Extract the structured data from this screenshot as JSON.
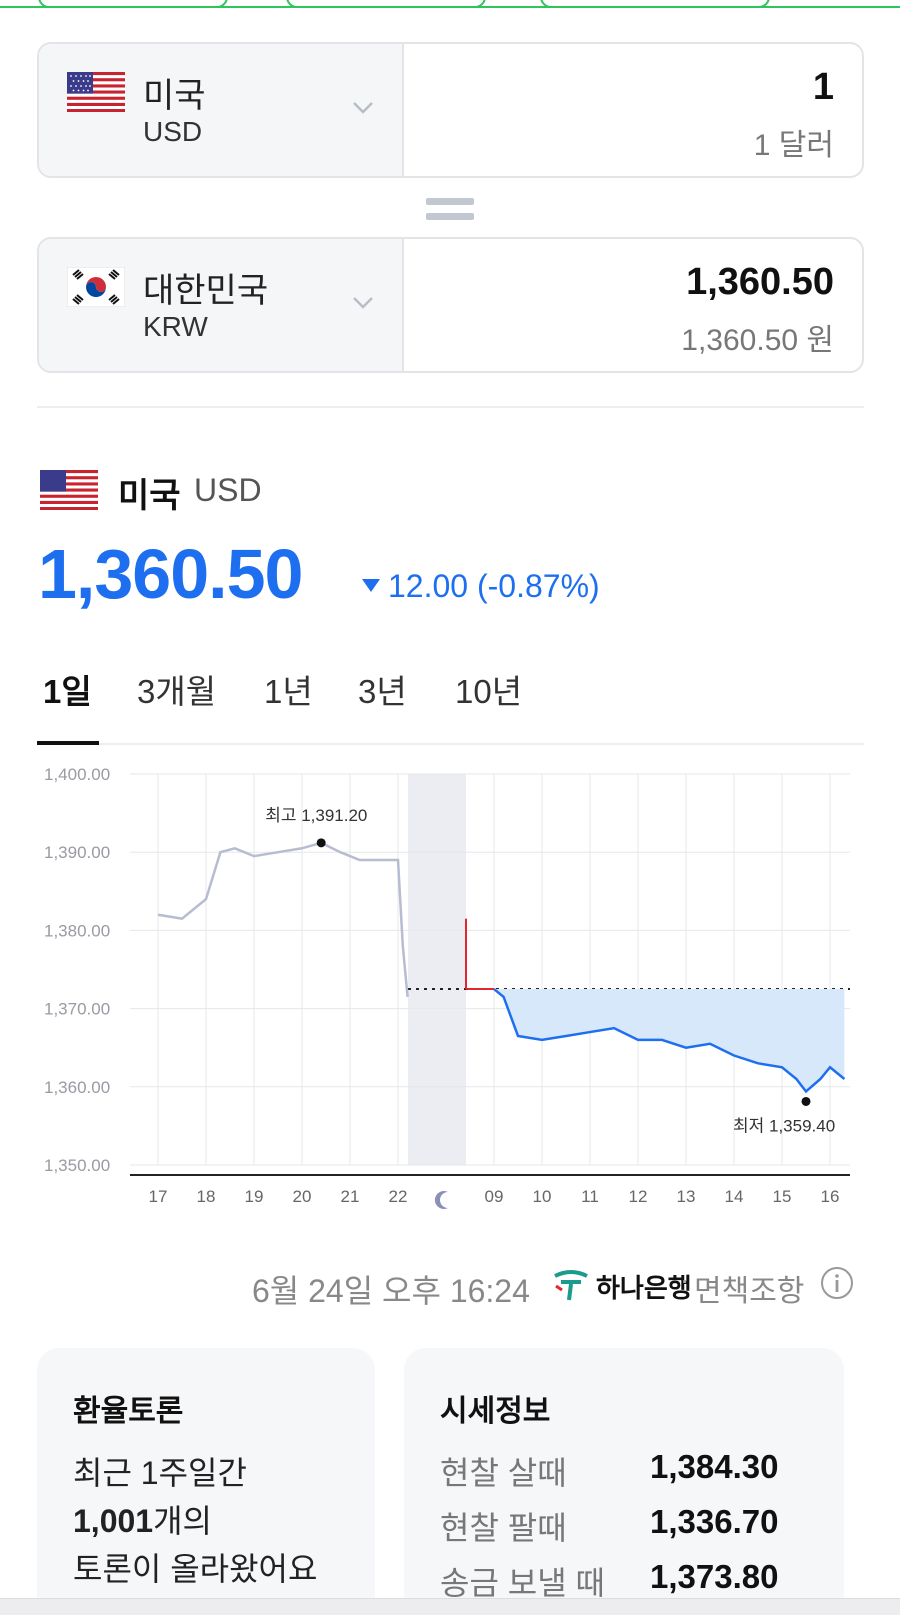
{
  "converter": {
    "from": {
      "country": "미국",
      "code": "USD",
      "amount": "1",
      "amount_text": "1 달러"
    },
    "to": {
      "country": "대한민국",
      "code": "KRW",
      "amount": "1,360.50",
      "amount_text": "1,360.50 원"
    }
  },
  "currency_header": {
    "name": "미국",
    "code": "USD",
    "price": "1,360.50",
    "change": "12.00 (-0.87%)"
  },
  "tabs": [
    "1일",
    "3개월",
    "1년",
    "3년",
    "10년"
  ],
  "active_tab": "1일",
  "chart_data": {
    "type": "line",
    "y_ticks": [
      "1,400.00",
      "1,390.00",
      "1,380.00",
      "1,370.00",
      "1,360.00",
      "1,350.00"
    ],
    "ylim": [
      1350,
      1400
    ],
    "x_ticks": [
      "17",
      "18",
      "19",
      "20",
      "21",
      "22",
      "09",
      "10",
      "11",
      "12",
      "13",
      "14",
      "15",
      "16"
    ],
    "high_label": "최고 1,391.20",
    "low_label": "최저 1,359.40",
    "reference_value": 1372.5,
    "series": [
      {
        "period": "previous-day",
        "x": [
          17,
          17.5,
          18,
          18.3,
          18.6,
          19,
          19.5,
          20,
          20.4,
          20.8,
          21.2,
          21.6,
          22,
          22.1,
          22.2
        ],
        "y": [
          1382,
          1381.5,
          1384,
          1390,
          1390.5,
          1389.5,
          1390,
          1390.5,
          1391.2,
          1390,
          1389,
          1389,
          1389,
          1378,
          1371.5
        ]
      },
      {
        "period": "today",
        "x": [
          9,
          9.2,
          9.5,
          10,
          10.5,
          11,
          11.5,
          12,
          12.5,
          13,
          13.5,
          14,
          14.5,
          15,
          15.3,
          15.5,
          15.8,
          16,
          16.3
        ],
        "y": [
          1372.5,
          1371.5,
          1366.5,
          1366,
          1366.5,
          1367,
          1367.5,
          1366,
          1366,
          1365,
          1365.5,
          1364,
          1363,
          1362.5,
          1361,
          1359.4,
          1361,
          1362.5,
          1361
        ]
      }
    ]
  },
  "timestamp": "6월 24일 오후 16:24",
  "bank": "하나은행",
  "disclaimer": "면책조항",
  "discussion": {
    "title": "환율토론",
    "line1": "최근 1주일간",
    "count": "1,001",
    "count_suffix": "개의",
    "line3": "토론이 올라왔어요"
  },
  "market_info": {
    "title": "시세정보",
    "rows": [
      {
        "label": "현찰 살때",
        "value": "1,384.30"
      },
      {
        "label": "현찰 팔때",
        "value": "1,336.70"
      },
      {
        "label": "송금 보낼 때",
        "value": "1,373.80"
      }
    ]
  },
  "colors": {
    "accent_blue": "#1e6ff0",
    "green": "#2fc45c",
    "prev_line": "#b8bcd0",
    "open_marker": "#e0282e"
  }
}
